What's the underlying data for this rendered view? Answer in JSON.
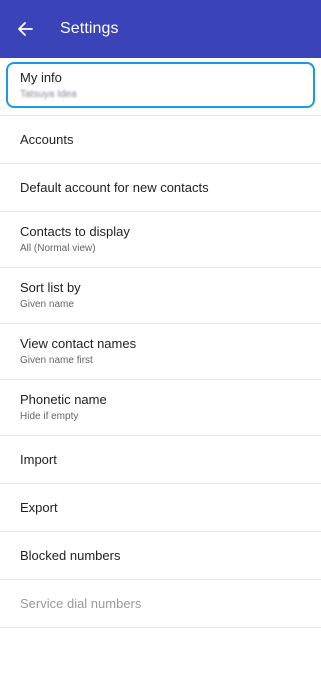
{
  "appbar": {
    "title": "Settings",
    "back_icon": "arrow-left-icon",
    "color": "#3a44b8"
  },
  "my_info": {
    "label": "My info",
    "value": "Tatsuya Idea",
    "focus_color": "#1a9be0"
  },
  "items": [
    {
      "label": "Accounts",
      "sub": ""
    },
    {
      "label": "Default account for new contacts",
      "sub": ""
    },
    {
      "label": "Contacts to display",
      "sub": "All (Normal view)"
    },
    {
      "label": "Sort list by",
      "sub": "Given name"
    },
    {
      "label": "View contact names",
      "sub": "Given name first"
    },
    {
      "label": "Phonetic name",
      "sub": "Hide if empty"
    },
    {
      "label": "Import",
      "sub": ""
    },
    {
      "label": "Export",
      "sub": ""
    },
    {
      "label": "Blocked numbers",
      "sub": ""
    },
    {
      "label": "Service dial numbers",
      "sub": ""
    }
  ]
}
